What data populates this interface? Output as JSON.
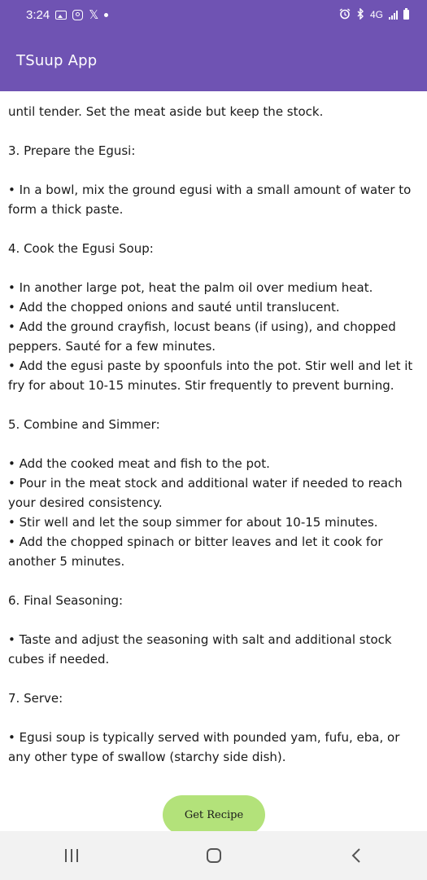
{
  "status_bar": {
    "time": "3:24",
    "network": "4G",
    "icons": [
      "image-icon",
      "instagram-icon",
      "x-icon",
      "dot-icon",
      "alarm-icon",
      "bluetooth-icon",
      "signal-icon",
      "battery-icon"
    ]
  },
  "app_bar": {
    "title": "TSuup App",
    "color": "#6f53b3"
  },
  "recipe_lines": [
    "until tender. Set the meat aside but keep the stock.",
    "",
    "3. Prepare the Egusi:",
    "",
    "• In a bowl, mix the ground egusi with a small amount of water to",
    "form a thick paste.",
    "",
    "4. Cook the Egusi Soup:",
    "",
    "• In another large pot, heat the palm oil over medium heat.",
    "• Add the chopped onions and sauté until translucent.",
    "• Add the ground crayfish, locust beans (if using), and chopped",
    "peppers. Sauté for a few minutes.",
    "• Add the egusi paste by spoonfuls into the pot. Stir well and let it",
    "fry for about 10-15 minutes. Stir frequently to prevent burning.",
    "",
    "5. Combine and Simmer:",
    "",
    "• Add the cooked meat and fish to the pot.",
    "• Pour in the meat stock and additional water if needed to reach",
    "your desired consistency.",
    "• Stir well and let the soup simmer for about 10-15 minutes.",
    "• Add the chopped spinach or bitter leaves and let it cook for",
    "another 5 minutes.",
    "",
    "6. Final Seasoning:",
    "",
    "• Taste and adjust the seasoning with salt and additional stock",
    "cubes if needed.",
    "",
    "7. Serve:",
    "",
    "• Egusi soup is typically served with pounded yam, fufu, eba, or",
    "any other type of swallow (starchy side dish)."
  ],
  "button": {
    "label": "Get Recipe",
    "color": "#b3e27a"
  },
  "nav": {
    "icons": [
      "recent-apps-icon",
      "home-icon",
      "back-icon"
    ]
  }
}
